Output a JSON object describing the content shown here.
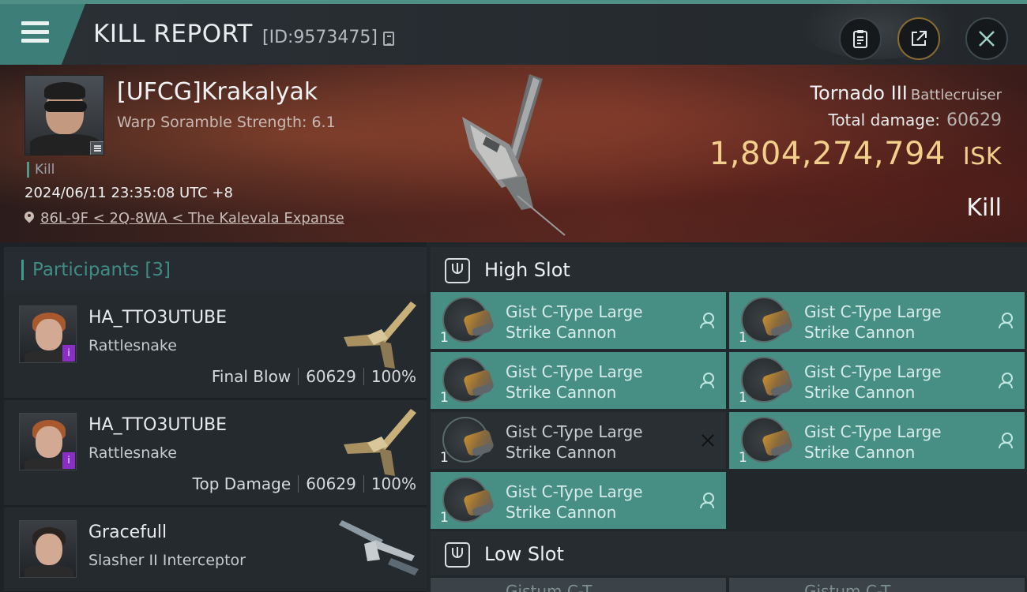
{
  "header": {
    "title": "KILL REPORT",
    "report_id": "[ID:9573475]",
    "icons": {
      "menu": "hamburger-menu-icon",
      "copy": "copy-icon",
      "clipboard": "clipboard-icon",
      "share": "share-icon",
      "close": "close-icon"
    }
  },
  "victim": {
    "name": "[UFCG]Krakalyak",
    "warp_scramble": "Warp Soramble Strength: 6.1",
    "kill_tag": "Kill",
    "timestamp": "2024/06/11 23:35:08 UTC +8",
    "location": "86L-9F < 2Q-8WA < The Kalevala Expanse",
    "ship_name": "Tornado III",
    "ship_class": "Battlecruiser",
    "total_damage_label": "Total damage:",
    "total_damage": "60629",
    "isk_value": "1,804,274,794",
    "isk_unit": "ISK",
    "result_label": "Kill"
  },
  "participants": {
    "header": "Participants [3]",
    "items": [
      {
        "name": "HA_TTO3UTUBE",
        "ship": "Rattlesnake",
        "role": "Final Blow",
        "damage": "60629",
        "percent": "100%",
        "badge": "i"
      },
      {
        "name": "HA_TTO3UTUBE",
        "ship": "Rattlesnake",
        "role": "Top Damage",
        "damage": "60629",
        "percent": "100%",
        "badge": "i"
      },
      {
        "name": "Gracefull",
        "ship": "Slasher II Interceptor"
      }
    ]
  },
  "slots": {
    "high_slot_label": "High Slot",
    "low_slot_label": "Low Slot",
    "high_modules": [
      {
        "name": "Gist C-Type Large Strike Cannon",
        "qty": "1",
        "state": "destroyed"
      },
      {
        "name": "Gist C-Type Large Strike Cannon",
        "qty": "1",
        "state": "destroyed"
      },
      {
        "name": "Gist C-Type Large Strike Cannon",
        "qty": "1",
        "state": "destroyed"
      },
      {
        "name": "Gist C-Type Large Strike Cannon",
        "qty": "1",
        "state": "destroyed"
      },
      {
        "name": "Gist C-Type Large Strike Cannon",
        "qty": "1",
        "state": "dropped"
      },
      {
        "name": "Gist C-Type Large Strike Cannon",
        "qty": "1",
        "state": "destroyed"
      },
      {
        "name": "Gist C-Type Large Strike Cannon",
        "qty": "1",
        "state": "destroyed"
      }
    ],
    "low_peek": [
      "Gistum C-T",
      "Gistum C-T"
    ]
  },
  "colors": {
    "accent_teal": "#478f84",
    "isk_gold": "#f2cf8a",
    "participants_header": "#3f8c84",
    "badge_purple": "#8a2fc4"
  }
}
